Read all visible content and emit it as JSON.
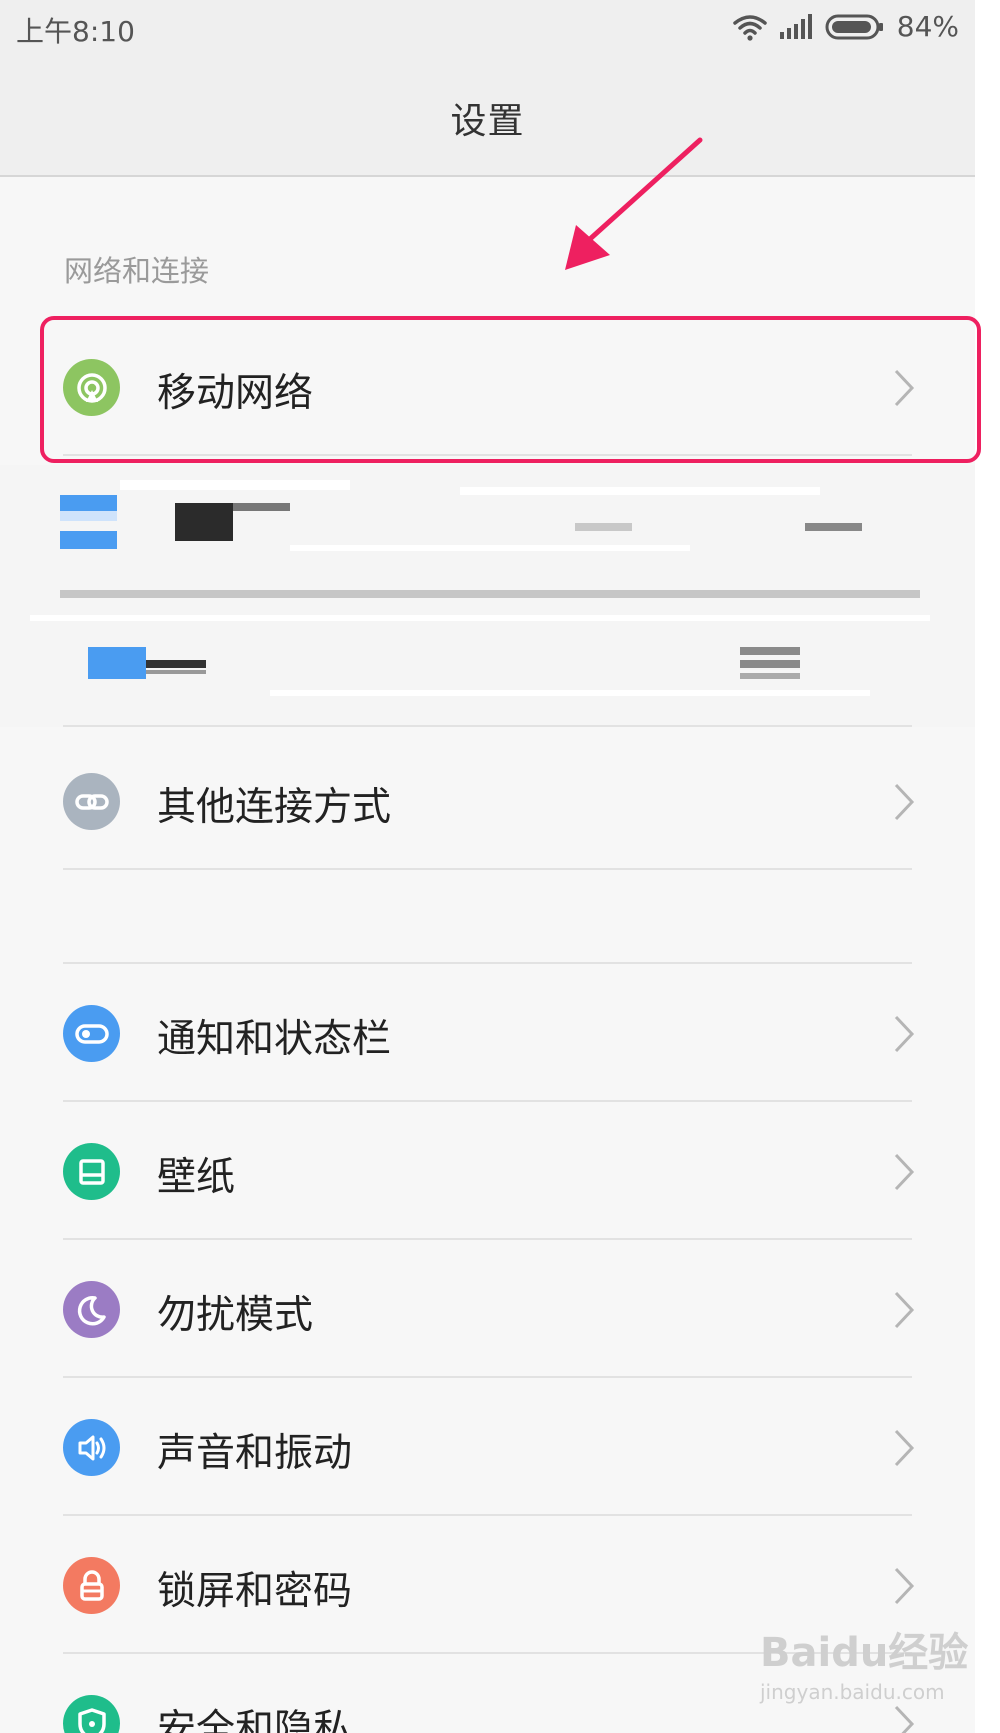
{
  "status_bar": {
    "time": "上午8:10",
    "battery": "84%"
  },
  "header": {
    "title": "设置"
  },
  "section_network": {
    "header": "网络和连接"
  },
  "items": [
    {
      "label": "移动网络",
      "icon": "cellular-signal-icon",
      "color": "#8dc561"
    },
    {
      "label": "其他连接方式",
      "icon": "link-icon",
      "color": "#aab4bf"
    },
    {
      "label": "通知和状态栏",
      "icon": "toggle-icon",
      "color": "#4a9cf1"
    },
    {
      "label": "壁纸",
      "icon": "wallpaper-icon",
      "color": "#1fbd8b"
    },
    {
      "label": "勿扰模式",
      "icon": "moon-icon",
      "color": "#9b7cc4"
    },
    {
      "label": "声音和振动",
      "icon": "speaker-icon",
      "color": "#4a9cf1"
    },
    {
      "label": "锁屏和密码",
      "icon": "lock-icon",
      "color": "#f37a61"
    },
    {
      "label": "安全和隐私",
      "icon": "shield-icon",
      "color": "#1fbd8b"
    }
  ],
  "annotation": {
    "color": "#ee2060"
  },
  "watermark": {
    "brand": "Baidu经验",
    "url": "jingyan.baidu.com"
  }
}
